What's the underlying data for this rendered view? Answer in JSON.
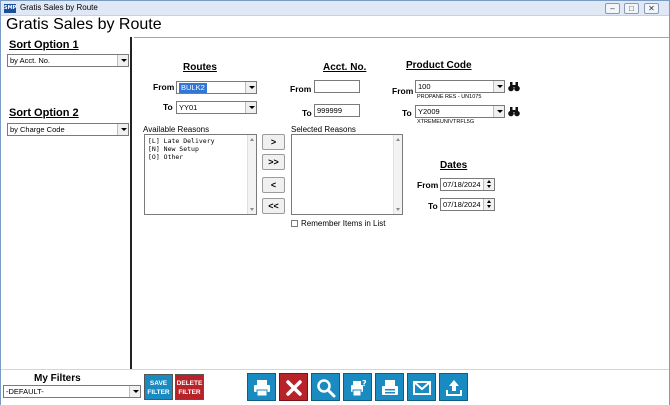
{
  "window": {
    "title": "Gratis Sales by Route",
    "icon_text": "SMP",
    "controls": [
      "minimize-icon",
      "restore-icon",
      "close-icon"
    ]
  },
  "page": {
    "title": "Gratis Sales by Route"
  },
  "sort_option_1": {
    "label": "Sort Option 1",
    "value": "by Acct. No."
  },
  "sort_option_2": {
    "label": "Sort Option 2",
    "value": "by Charge Code"
  },
  "routes": {
    "heading": "Routes",
    "from_label": "From",
    "from_value": "BULK2",
    "to_label": "To",
    "to_value": "YY01"
  },
  "acct": {
    "heading": "Acct. No.",
    "from_label": "From",
    "from_value": "",
    "to_label": "To",
    "to_value": "999999"
  },
  "product": {
    "heading": "Product Code",
    "from_label": "From",
    "from_value": "100",
    "from_desc": "PROPANE RES - UN1075",
    "to_label": "To",
    "to_value": "Y2009",
    "to_desc": "XTREMEUNIVTRFL5G"
  },
  "reasons": {
    "available_label": "Available Reasons",
    "available": [
      "[L] Late Delivery",
      "[N] New Setup",
      "[O] Other"
    ],
    "selected_label": "Selected Reasons",
    "selected": [],
    "buttons": {
      "add": ">",
      "add_all": ">>",
      "remove": "<",
      "remove_all": "<<"
    },
    "remember_label": "Remember Items in List",
    "remember_checked": false
  },
  "dates": {
    "heading": "Dates",
    "from_label": "From",
    "from_value": "07/18/2024",
    "to_label": "To",
    "to_value": "07/18/2024"
  },
  "filters": {
    "label": "My Filters",
    "value": "-DEFAULT-",
    "save_label_1": "SAVE",
    "save_label_2": "FILTER",
    "delete_label_1": "DELETE",
    "delete_label_2": "FILTER",
    "save_color": "#1a8bc0",
    "delete_color": "#b8232a"
  },
  "toolbar": {
    "buttons": [
      "print-icon",
      "cancel-icon",
      "search-icon",
      "print-preview-icon",
      "fax-icon",
      "email-icon",
      "export-icon"
    ],
    "accent": "#1a8bc0",
    "cancel_color": "#b8232a"
  }
}
